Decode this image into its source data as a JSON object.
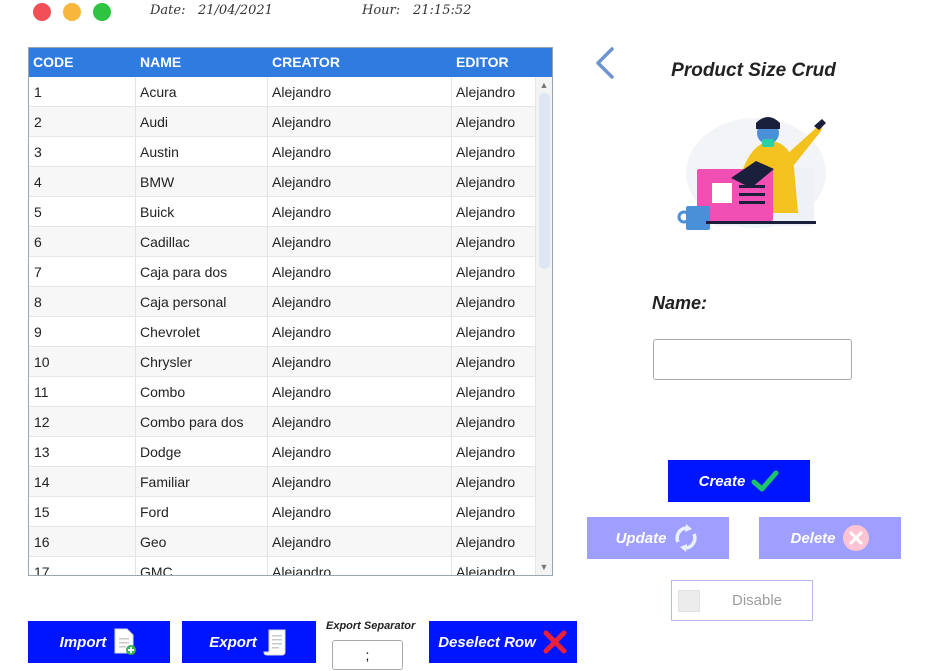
{
  "header": {
    "date_label": "Date:",
    "date_value": "21/04/2021",
    "hour_label": "Hour:",
    "hour_value": "21:15:52"
  },
  "table": {
    "columns": [
      "CODE",
      "NAME",
      "CREATOR",
      "EDITOR"
    ],
    "rows": [
      [
        "1",
        "Acura",
        "Alejandro",
        "Alejandro"
      ],
      [
        "2",
        "Audi",
        "Alejandro",
        "Alejandro"
      ],
      [
        "3",
        "Austin",
        "Alejandro",
        "Alejandro"
      ],
      [
        "4",
        "BMW",
        "Alejandro",
        "Alejandro"
      ],
      [
        "5",
        "Buick",
        "Alejandro",
        "Alejandro"
      ],
      [
        "6",
        "Cadillac",
        "Alejandro",
        "Alejandro"
      ],
      [
        "7",
        "Caja para dos",
        "Alejandro",
        "Alejandro"
      ],
      [
        "8",
        "Caja personal",
        "Alejandro",
        "Alejandro"
      ],
      [
        "9",
        "Chevrolet",
        "Alejandro",
        "Alejandro"
      ],
      [
        "10",
        "Chrysler",
        "Alejandro",
        "Alejandro"
      ],
      [
        "11",
        "Combo",
        "Alejandro",
        "Alejandro"
      ],
      [
        "12",
        "Combo para dos",
        "Alejandro",
        "Alejandro"
      ],
      [
        "13",
        "Dodge",
        "Alejandro",
        "Alejandro"
      ],
      [
        "14",
        "Familiar",
        "Alejandro",
        "Alejandro"
      ],
      [
        "15",
        "Ford",
        "Alejandro",
        "Alejandro"
      ],
      [
        "16",
        "Geo",
        "Alejandro",
        "Alejandro"
      ],
      [
        "17",
        "GMC",
        "Alejandro",
        "Alejandro"
      ]
    ]
  },
  "panel": {
    "title": "Product Size Crud",
    "name_label": "Name:",
    "name_value": "",
    "create_label": "Create",
    "update_label": "Update",
    "delete_label": "Delete",
    "disable_label": "Disable"
  },
  "footer": {
    "import_label": "Import",
    "export_label": "Export",
    "separator_label": "Export Separator",
    "separator_value": ";",
    "deselect_label": "Deselect Row"
  },
  "colors": {
    "primary": "#0015ff",
    "disabled": "#9f9fff",
    "header": "#2f7be0",
    "check": "#1ec36b",
    "danger": "#e8203a"
  },
  "icons": [
    "back-arrow-icon",
    "document-add-icon",
    "scroll-icon",
    "check-icon",
    "refresh-icon",
    "close-circle-icon",
    "x-icon"
  ]
}
